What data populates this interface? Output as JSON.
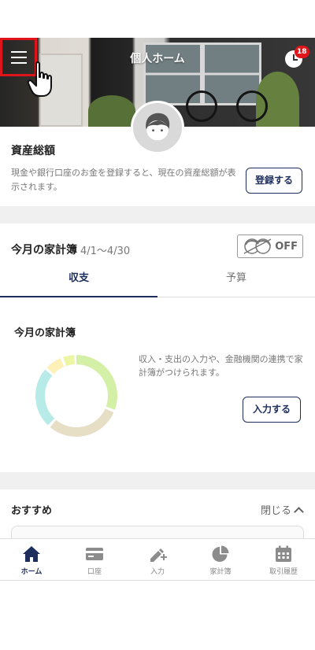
{
  "header": {
    "title": "個人ホーム",
    "menu_icon": "hamburger-menu-icon",
    "notification_icon": "clock-icon",
    "notification_count": "18"
  },
  "assets": {
    "title": "資産総額",
    "description": "現金や銀行口座のお金を登録すると、現在の資産総額が表示されます。",
    "button": "登録する"
  },
  "budget": {
    "title": "今月の家計簿",
    "range": "4/1〜4/30",
    "toggle_label": "OFF",
    "tabs": [
      {
        "label": "収支",
        "active": true
      },
      {
        "label": "予算",
        "active": false
      }
    ],
    "section_title": "今月の家計簿",
    "description": "収入・支出の入力や、金融機関の連携で家計簿がつけられます。",
    "button": "入力する",
    "donut_colors": [
      "#d4f0a6",
      "#e6dec5",
      "#b7ebe8",
      "#fdf1b8",
      "#ecf6a4"
    ]
  },
  "recommend": {
    "title": "おすすめ",
    "close": "閉じる"
  },
  "bottom_nav": [
    {
      "label": "ホーム",
      "icon": "home-icon",
      "active": true
    },
    {
      "label": "口座",
      "icon": "card-icon",
      "active": false
    },
    {
      "label": "入力",
      "icon": "pen-plus-icon",
      "active": false
    },
    {
      "label": "家計簿",
      "icon": "pie-chart-icon",
      "active": false
    },
    {
      "label": "取引履歴",
      "icon": "calendar-icon",
      "active": false
    }
  ],
  "colors": {
    "accent": "#1d2e5c",
    "highlight": "#e0151b"
  }
}
